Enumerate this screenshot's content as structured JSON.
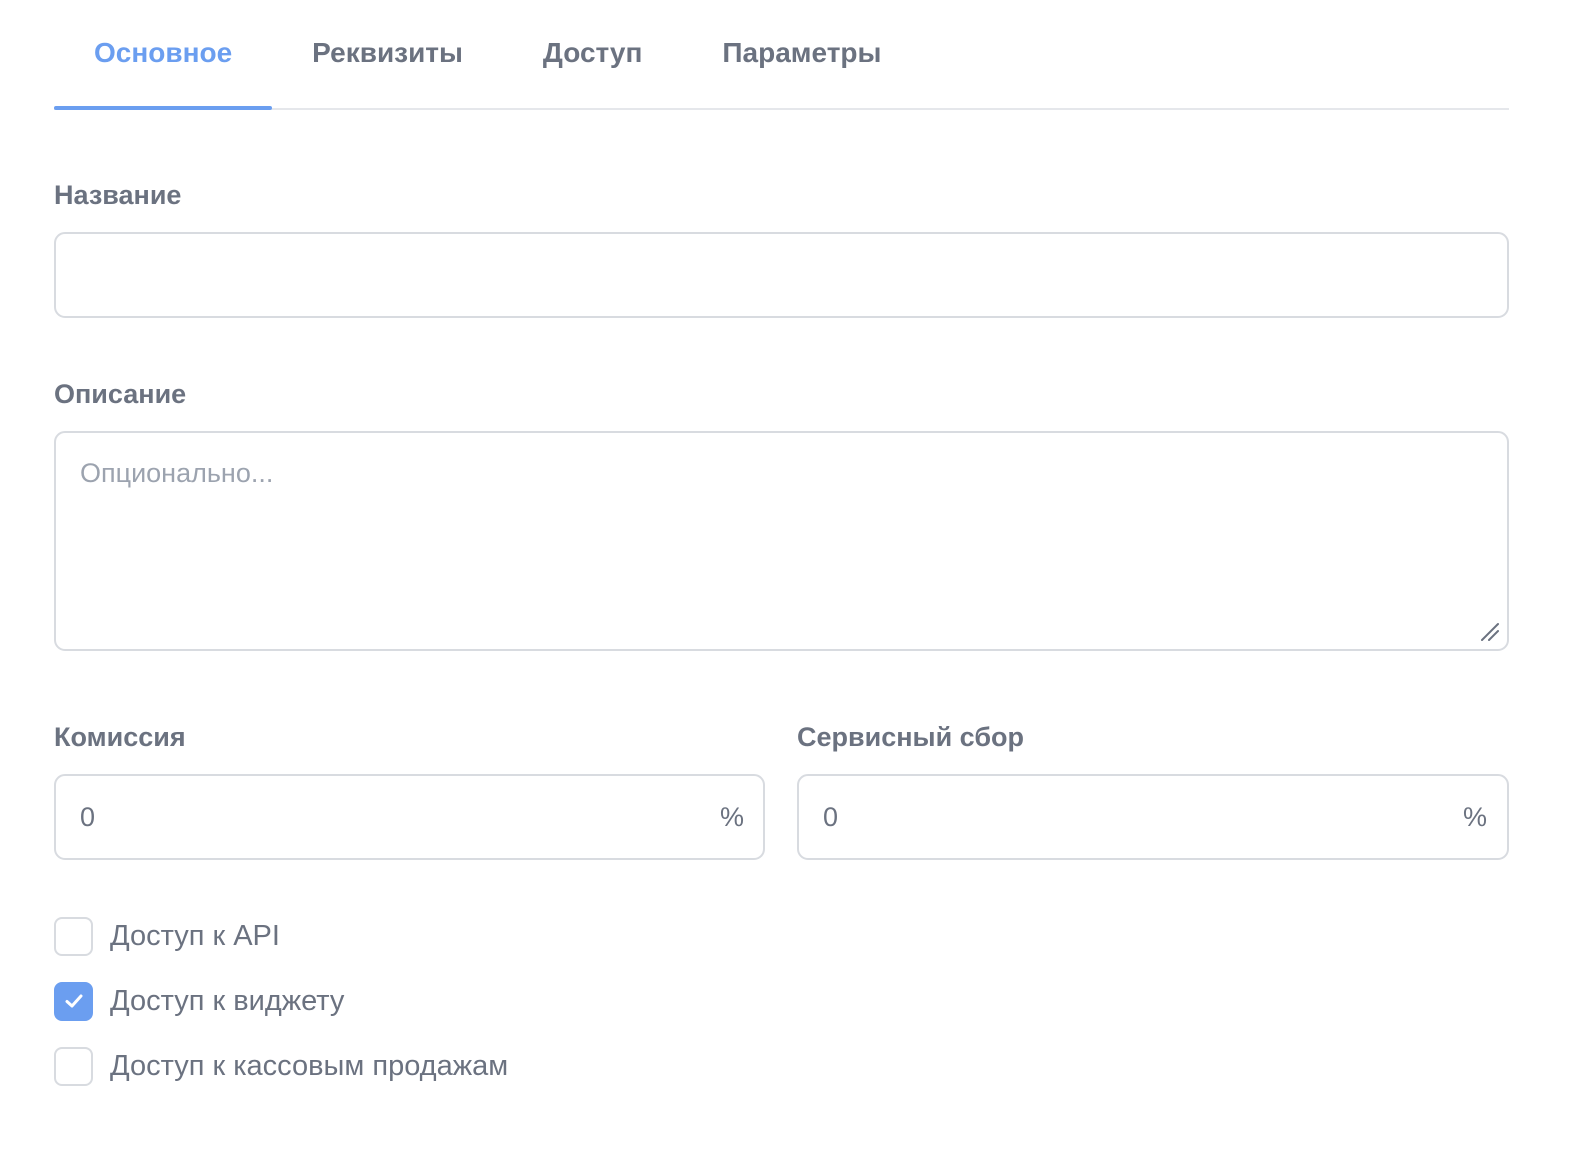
{
  "tabs": [
    {
      "label": "Основное",
      "active": true
    },
    {
      "label": "Реквизиты",
      "active": false
    },
    {
      "label": "Доступ",
      "active": false
    },
    {
      "label": "Параметры",
      "active": false
    }
  ],
  "form": {
    "name": {
      "label": "Название",
      "value": ""
    },
    "description": {
      "label": "Описание",
      "placeholder": "Опционально...",
      "value": ""
    },
    "commission": {
      "label": "Комиссия",
      "value": "0",
      "suffix": "%"
    },
    "service_fee": {
      "label": "Сервисный сбор",
      "value": "0",
      "suffix": "%"
    }
  },
  "checkboxes": [
    {
      "label": "Доступ к API",
      "checked": false
    },
    {
      "label": "Доступ к виджету",
      "checked": true
    },
    {
      "label": "Доступ к кассовым продажам",
      "checked": false
    }
  ],
  "colors": {
    "accent": "#6b9ef0",
    "text": "#6b7280",
    "border": "#d8dbe0",
    "placeholder": "#9ca3af"
  }
}
